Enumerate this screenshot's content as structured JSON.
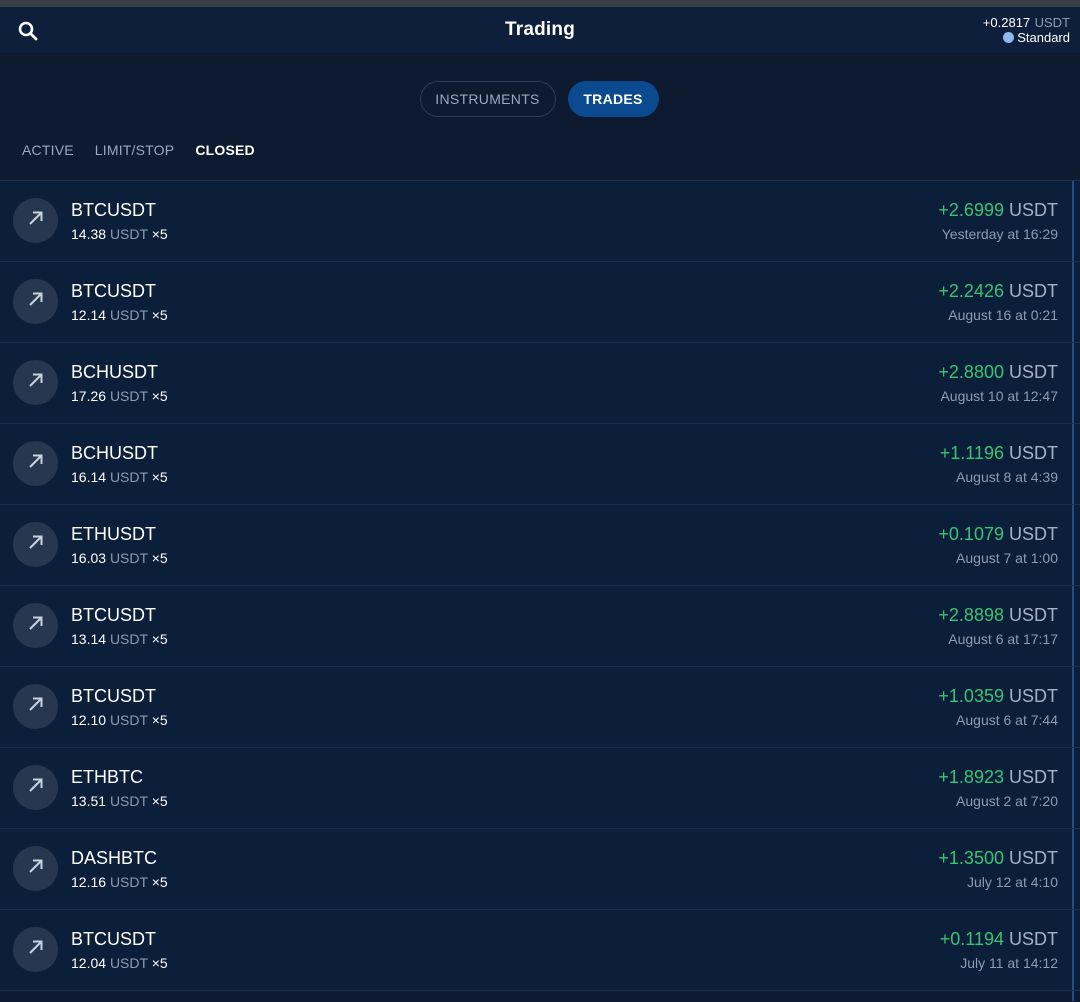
{
  "header": {
    "title": "Trading",
    "balance_value": "+0.2817",
    "balance_unit": "USDT",
    "account_type": "Standard",
    "search_icon": "search-icon"
  },
  "segments": {
    "instruments": "INSTRUMENTS",
    "trades": "TRADES",
    "active": "trades"
  },
  "subtabs": {
    "active": "ACTIVE",
    "limit_stop": "LIMIT/STOP",
    "closed": "CLOSED",
    "selected": "closed"
  },
  "colors": {
    "profit": "#3cc273",
    "accent": "#0b4a8e",
    "background": "#0c1f3a"
  },
  "trades": [
    {
      "symbol": "BTCUSDT",
      "amount": "14.38",
      "unit": "USDT",
      "leverage": "×5",
      "pnl": "+2.6999",
      "pnl_unit": "USDT",
      "time": "Yesterday at 16:29",
      "direction_icon": "arrow-up-right-icon"
    },
    {
      "symbol": "BTCUSDT",
      "amount": "12.14",
      "unit": "USDT",
      "leverage": "×5",
      "pnl": "+2.2426",
      "pnl_unit": "USDT",
      "time": "August 16 at 0:21",
      "direction_icon": "arrow-up-right-icon"
    },
    {
      "symbol": "BCHUSDT",
      "amount": "17.26",
      "unit": "USDT",
      "leverage": "×5",
      "pnl": "+2.8800",
      "pnl_unit": "USDT",
      "time": "August 10 at 12:47",
      "direction_icon": "arrow-up-right-icon"
    },
    {
      "symbol": "BCHUSDT",
      "amount": "16.14",
      "unit": "USDT",
      "leverage": "×5",
      "pnl": "+1.1196",
      "pnl_unit": "USDT",
      "time": "August 8 at 4:39",
      "direction_icon": "arrow-up-right-icon"
    },
    {
      "symbol": "ETHUSDT",
      "amount": "16.03",
      "unit": "USDT",
      "leverage": "×5",
      "pnl": "+0.1079",
      "pnl_unit": "USDT",
      "time": "August 7 at 1:00",
      "direction_icon": "arrow-up-right-icon"
    },
    {
      "symbol": "BTCUSDT",
      "amount": "13.14",
      "unit": "USDT",
      "leverage": "×5",
      "pnl": "+2.8898",
      "pnl_unit": "USDT",
      "time": "August 6 at 17:17",
      "direction_icon": "arrow-up-right-icon"
    },
    {
      "symbol": "BTCUSDT",
      "amount": "12.10",
      "unit": "USDT",
      "leverage": "×5",
      "pnl": "+1.0359",
      "pnl_unit": "USDT",
      "time": "August 6 at 7:44",
      "direction_icon": "arrow-up-right-icon"
    },
    {
      "symbol": "ETHBTC",
      "amount": "13.51",
      "unit": "USDT",
      "leverage": "×5",
      "pnl": "+1.8923",
      "pnl_unit": "USDT",
      "time": "August 2 at 7:20",
      "direction_icon": "arrow-up-right-icon"
    },
    {
      "symbol": "DASHBTC",
      "amount": "12.16",
      "unit": "USDT",
      "leverage": "×5",
      "pnl": "+1.3500",
      "pnl_unit": "USDT",
      "time": "July 12 at 4:10",
      "direction_icon": "arrow-up-right-icon"
    },
    {
      "symbol": "BTCUSDT",
      "amount": "12.04",
      "unit": "USDT",
      "leverage": "×5",
      "pnl": "+0.1194",
      "pnl_unit": "USDT",
      "time": "July 11 at 14:12",
      "direction_icon": "arrow-up-right-icon"
    }
  ]
}
